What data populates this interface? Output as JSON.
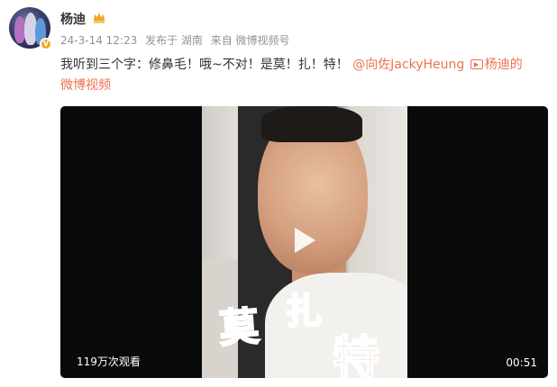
{
  "post": {
    "author": "杨迪",
    "meta": {
      "date": "24-3-14 12:23",
      "location": "发布于 湖南",
      "source": "来自 微博视频号"
    },
    "text_plain": "我听到三个字：修鼻毛！哦~不对！是莫！扎！特！",
    "mention": "@向佐JackyHeung",
    "video_link_part1": "杨迪的",
    "video_link_part2": "微博视频"
  },
  "video": {
    "captions": [
      "莫",
      "扎",
      "特"
    ],
    "views": "119万次观看",
    "duration": "00:51"
  },
  "colors": {
    "link": "#eb7350",
    "meta": "#939393",
    "badge": "#f5a623"
  },
  "icons": [
    "crown-icon",
    "verified-badge-icon",
    "video-link-icon",
    "play-icon"
  ]
}
